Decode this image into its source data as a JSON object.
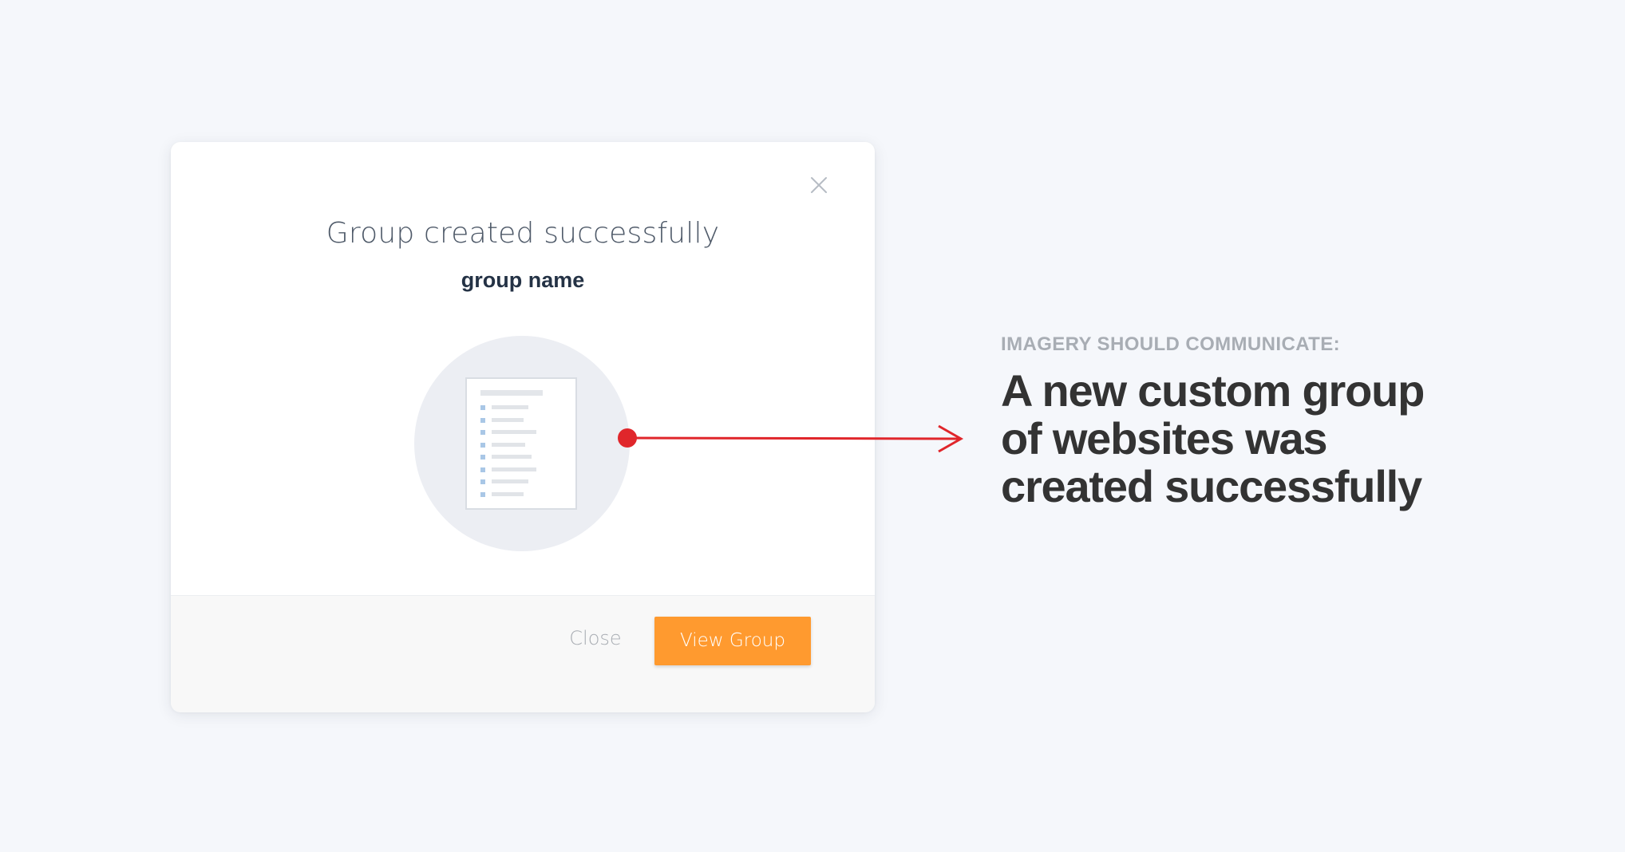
{
  "modal": {
    "title": "Group created successfully",
    "subtitle": "group name",
    "close_icon": "close-icon",
    "illustration": "document-list-icon",
    "footer": {
      "close_label": "Close",
      "view_label": "View Group"
    }
  },
  "caption": {
    "label": "IMAGERY SHOULD COMMUNICATE:",
    "headline": "A new custom group of websites was created successfully"
  },
  "colors": {
    "background": "#f5f7fb",
    "primary_button": "#ff9a2f",
    "annotation": "#e0262b",
    "illustration_circle": "#eceef3"
  }
}
